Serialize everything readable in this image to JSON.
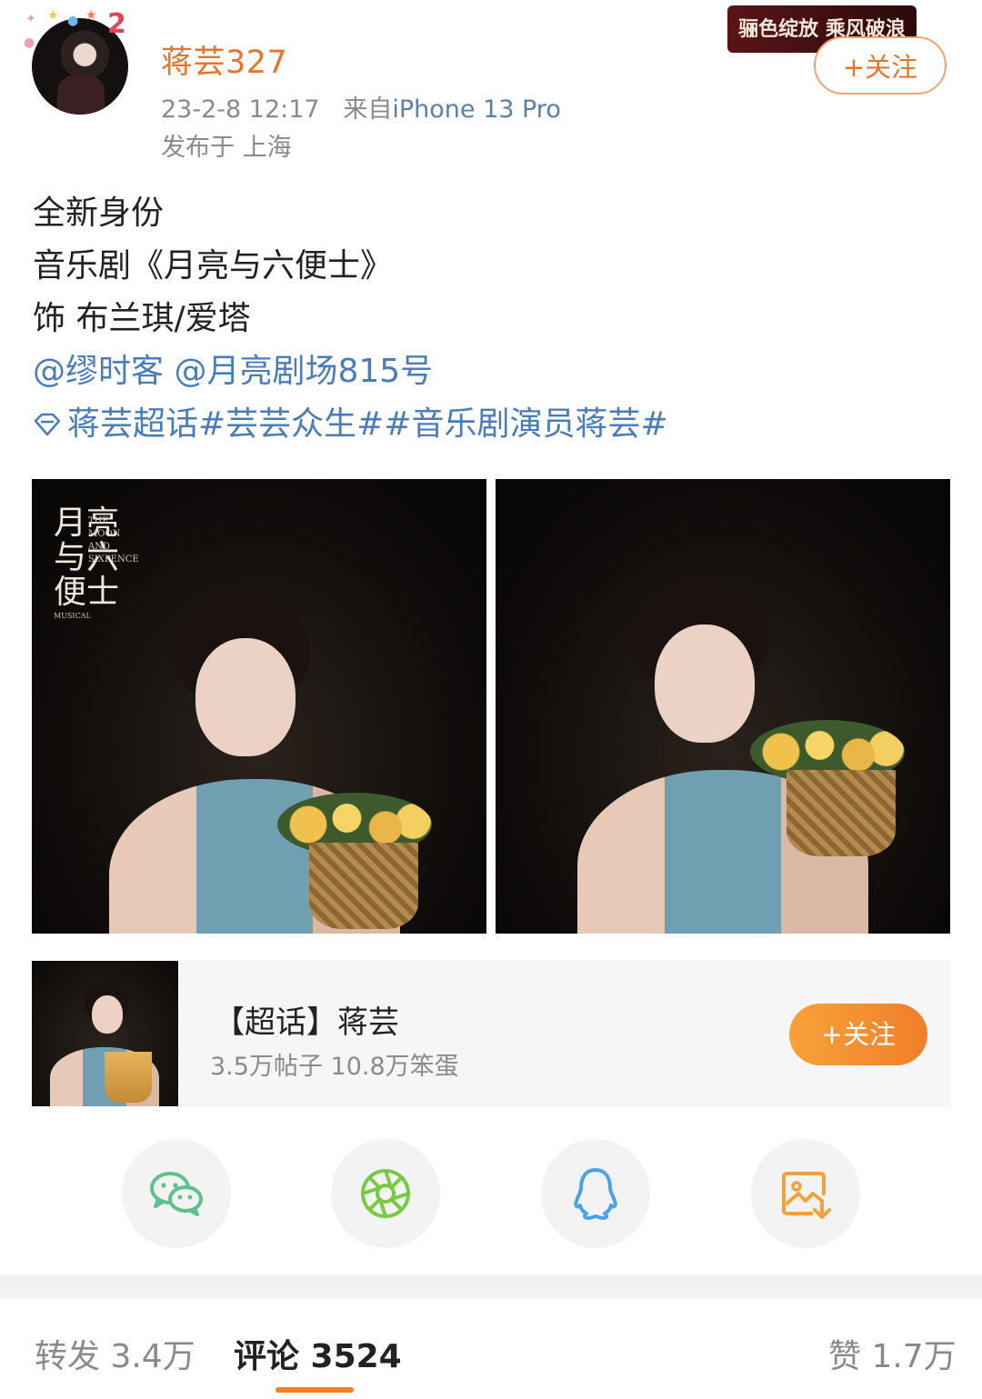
{
  "post": {
    "username": "蒋芸327",
    "timestamp": "23-2-8 12:17",
    "source_prefix": "来自",
    "device": "iPhone 13 Pro",
    "location": "发布于 上海",
    "banner_text": "骊色绽放 乘风破浪",
    "follow_label": "+关注",
    "text_lines": [
      "全新身份",
      "音乐剧《月亮与六便士》",
      "饰 布兰琪/爱塔"
    ],
    "mentions": "@缪时客 @月亮剧场815号",
    "topics": "蒋芸超话#芸芸众生##音乐剧演员蒋芸#"
  },
  "photos": {
    "poster_title": "月亮与六便士",
    "poster_english": "THE MOON AND SIXPENCE",
    "poster_sub": "MUSICAL"
  },
  "topic_card": {
    "title": "【超话】蒋芸",
    "stats": "3.5万帖子 10.8万笨蛋",
    "follow_label": "+关注"
  },
  "share": {
    "icons": [
      "wechat-icon",
      "moments-icon",
      "qq-icon",
      "save-image-icon"
    ]
  },
  "stats_bar": {
    "repost": "转发 3.4万",
    "comments": "评论 3524",
    "likes": "赞 1.7万"
  },
  "colors": {
    "accent": "#e8742a",
    "link": "#4a7db8",
    "wechat": "#5cc18c",
    "moments": "#7ac943",
    "qq": "#4aa3e6",
    "save": "#f2a23a"
  }
}
